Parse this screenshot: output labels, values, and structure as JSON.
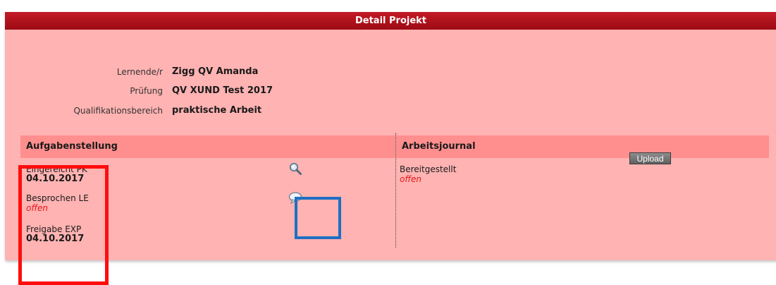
{
  "panel": {
    "title": "Detail Projekt",
    "colors": {
      "background": "#ffb3b2",
      "titlebar": "#b0131d",
      "header_bar": "#ff8f8e",
      "status_open": "#e4191b"
    }
  },
  "info": {
    "lernende_label": "Lernende/r",
    "lernende_value": "Zigg QV Amanda",
    "pruefung_label": "Prüfung",
    "pruefung_value": "QV XUND Test 2017",
    "bereich_label": "Qualifikationsbereich",
    "bereich_value": "praktische Arbeit"
  },
  "aufgabenstellung": {
    "header": "Aufgabenstellung",
    "items": [
      {
        "label": "Eingereicht PK",
        "value": "04.10.2017"
      },
      {
        "label": "Besprochen LE",
        "value": "offen"
      },
      {
        "label": "Freigabe EXP",
        "value": "04.10.2017"
      }
    ],
    "icons": [
      "magnifier-icon",
      "speech-bubble-icon"
    ]
  },
  "arbeitsjournal": {
    "header": "Arbeitsjournal",
    "label": "Bereitgestellt",
    "value": "offen",
    "upload_label": "Upload"
  },
  "annotations": {
    "red_box_color": "#ff0d0d",
    "blue_box_color": "#1d6fc2"
  }
}
